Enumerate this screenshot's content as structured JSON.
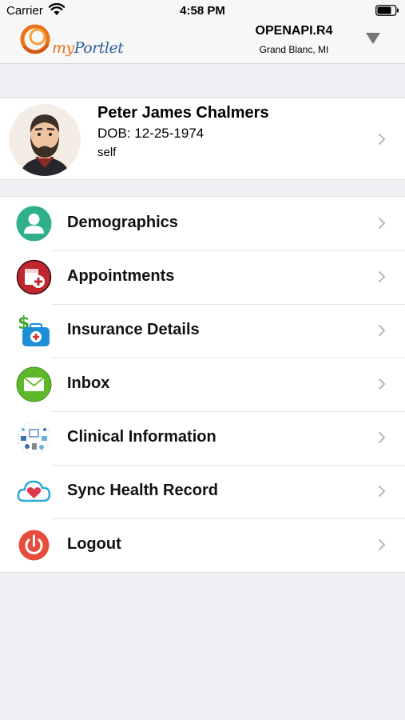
{
  "status_bar": {
    "carrier": "Carrier",
    "time": "4:58 PM"
  },
  "header": {
    "logo_text_my": "my",
    "logo_text_portlet": "Portlet",
    "org_name": "OPENAPI.R4",
    "org_location": "Grand Blanc, MI",
    "dropdown_icon": "triangle-down-icon"
  },
  "profile": {
    "name": "Peter James Chalmers",
    "dob": "DOB: 12-25-1974",
    "relation": "self"
  },
  "menu": [
    {
      "label": "Demographics",
      "icon": "person-icon"
    },
    {
      "label": "Appointments",
      "icon": "calendar-plus-icon"
    },
    {
      "label": "Insurance Details",
      "icon": "insurance-bag-icon"
    },
    {
      "label": "Inbox",
      "icon": "envelope-icon"
    },
    {
      "label": "Clinical Information",
      "icon": "clinical-icon"
    },
    {
      "label": "Sync Health Record",
      "icon": "cloud-heart-icon"
    },
    {
      "label": "Logout",
      "icon": "power-icon"
    }
  ],
  "colors": {
    "demographics": "#2fb08a",
    "appointments": "#c0272d",
    "insurance": "#1d8fd6",
    "inbox": "#5fb82b",
    "sync": "#2aa8d8",
    "logout": "#e74c3c",
    "accent_orange": "#e9731a",
    "accent_blue": "#2d5f9e"
  }
}
